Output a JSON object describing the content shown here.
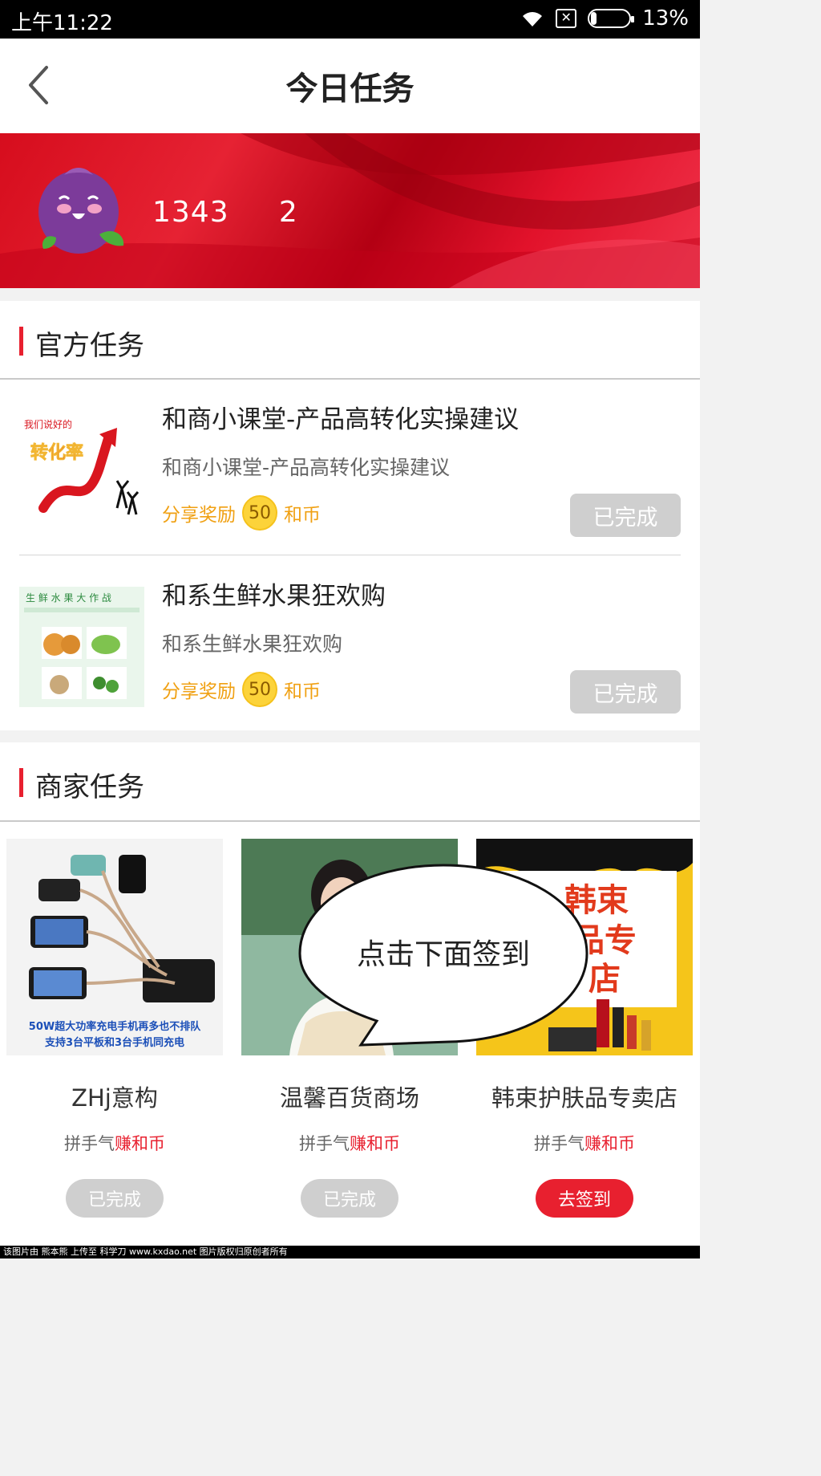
{
  "status_bar": {
    "time": "上午11:22",
    "battery": "13%"
  },
  "header": {
    "title": "今日任务"
  },
  "profile": {
    "user_id": "1343     2"
  },
  "official": {
    "section_title": "官方任务",
    "tasks": [
      {
        "title": "和商小课堂-产品高转化实操建议",
        "desc": "和商小课堂-产品高转化实操建议",
        "reward_prefix": "分享奖励",
        "reward_amount": "50",
        "reward_unit": "和币",
        "status": "已完成",
        "thumb_text1": "我们说好的",
        "thumb_text2": "转化率"
      },
      {
        "title": "和系生鲜水果狂欢购",
        "desc": "和系生鲜水果狂欢购",
        "reward_prefix": "分享奖励",
        "reward_amount": "50",
        "reward_unit": "和币",
        "status": "已完成",
        "thumb_text1": "生 鲜 水 果 大 作 战"
      }
    ]
  },
  "merchant": {
    "section_title": "商家任务",
    "items": [
      {
        "name": "ZHj意构",
        "sub_prefix": "拼手气",
        "sub_highlight": "赚和币",
        "button": "已完成",
        "img_caption1": "50W超大功率充电手机再多也不排队",
        "img_caption2": "支持3台平板和3台手机同充电"
      },
      {
        "name": "温馨百货商场",
        "sub_prefix": "拼手气",
        "sub_highlight": "赚和币",
        "button": "已完成"
      },
      {
        "name": "韩束护肤品专卖店",
        "sub_prefix": "拼手气",
        "sub_highlight": "赚和币",
        "button": "去签到",
        "img_caption1": "韩束",
        "img_caption2": "品专",
        "img_caption3": "店"
      }
    ]
  },
  "callout": {
    "text": "点击下面签到"
  },
  "footer": {
    "text": "该图片由 熊本熊 上传至 科学刀 www.kxdao.net 图片版权归原创者所有"
  },
  "colors": {
    "accent": "#e8202f",
    "reward": "#f0a012",
    "disabled": "#cfcfcf"
  }
}
